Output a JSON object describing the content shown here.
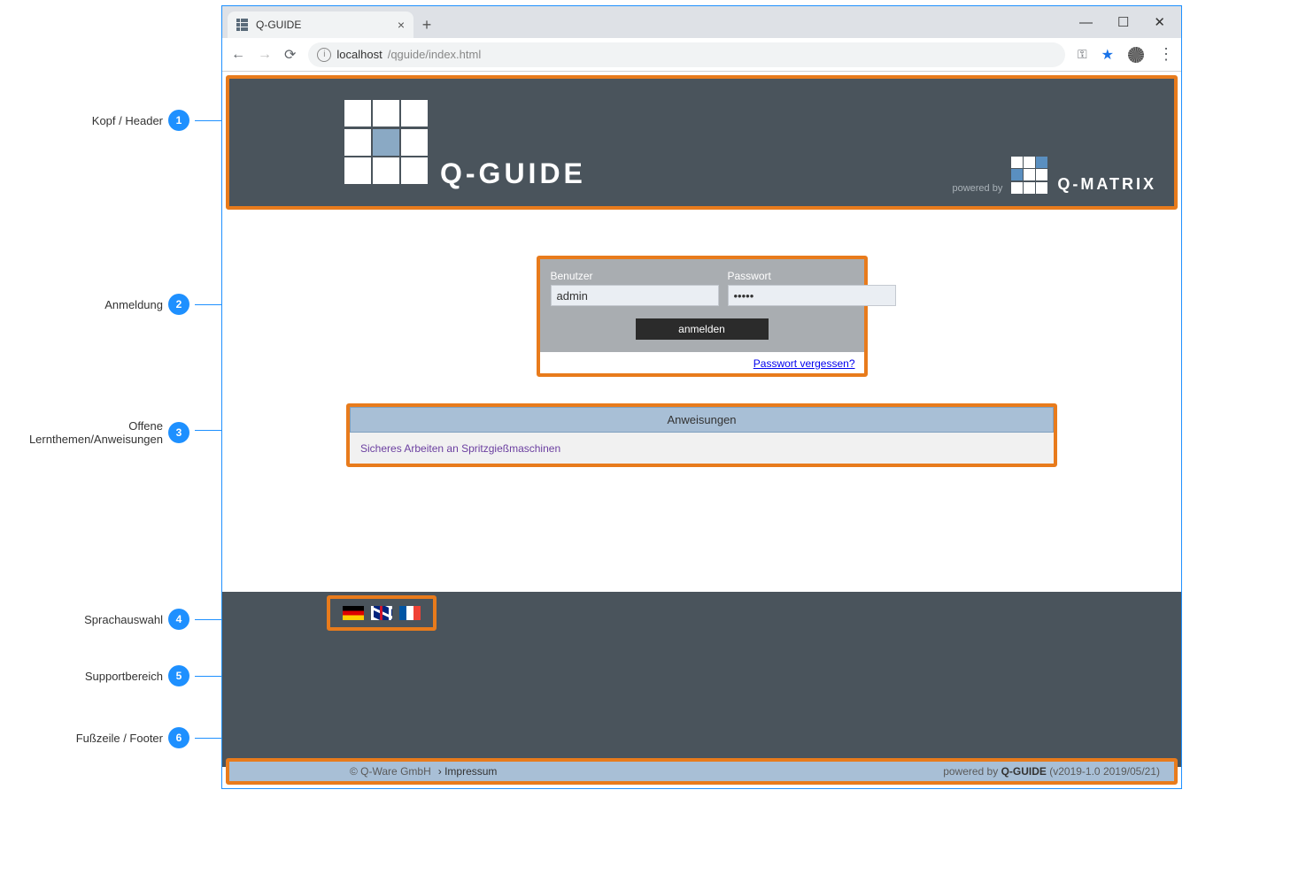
{
  "annotations": {
    "a1": "Kopf / Header",
    "a2": "Anmeldung",
    "a3": "Offene Lernthemen/Anweisungen",
    "a4": "Sprachauswahl",
    "a5": "Supportbereich",
    "a6": "Fußzeile / Footer"
  },
  "browser": {
    "tab_title": "Q-GUIDE",
    "url_host": "localhost",
    "url_path": "/qguide/index.html"
  },
  "header": {
    "logo_text": "Q-GUIDE",
    "powered_by": "powered by",
    "brand_right": "Q-MATRIX"
  },
  "login": {
    "user_label": "Benutzer",
    "user_value": "admin",
    "pass_label": "Passwort",
    "pass_value": "•••••",
    "submit": "anmelden",
    "forgot": "Passwort vergessen?"
  },
  "anweisungen": {
    "header": "Anweisungen",
    "items": [
      "Sicheres Arbeiten an Spritzgießmaschinen"
    ]
  },
  "languages": [
    "de",
    "uk",
    "fr"
  ],
  "footer": {
    "copyright": "© Q-Ware GmbH",
    "impressum": "› Impressum",
    "powered_prefix": "powered by ",
    "powered_name": "Q-GUIDE",
    "version": " (v2019-1.0 2019/05/21)"
  }
}
